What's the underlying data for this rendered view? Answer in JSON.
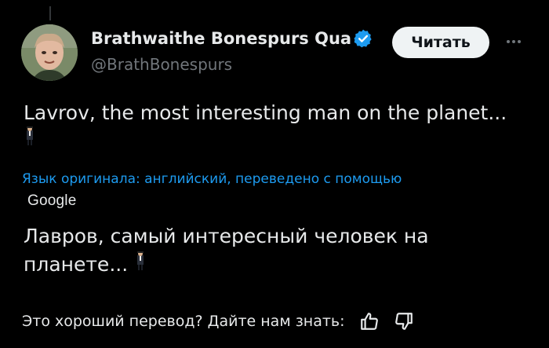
{
  "author": {
    "display_name": "Brathwaithe Bonespurs Qua",
    "handle": "@BrathBonespurs",
    "verified": true,
    "avatar": "avatar-photo"
  },
  "actions": {
    "follow_label": "Читать",
    "more_icon": "more-horizontal-icon"
  },
  "tweet": {
    "text": "Lavrov, the most interesting man on the planet...",
    "emoji": "man-in-business-suit-levitating"
  },
  "translation": {
    "note": "Язык оригинала: английский, переведено с помощью",
    "provider": "Google",
    "text": "Лавров, самый интересный человек на планете..."
  },
  "feedback": {
    "prompt": "Это хороший перевод? Дайте нам знать:",
    "thumbs_up_icon": "thumbs-up-icon",
    "thumbs_down_icon": "thumbs-down-icon"
  },
  "colors": {
    "background": "#000000",
    "text": "#e7e9ea",
    "muted": "#71767b",
    "link": "#1d9bf0",
    "verified": "#1d9bf0"
  }
}
